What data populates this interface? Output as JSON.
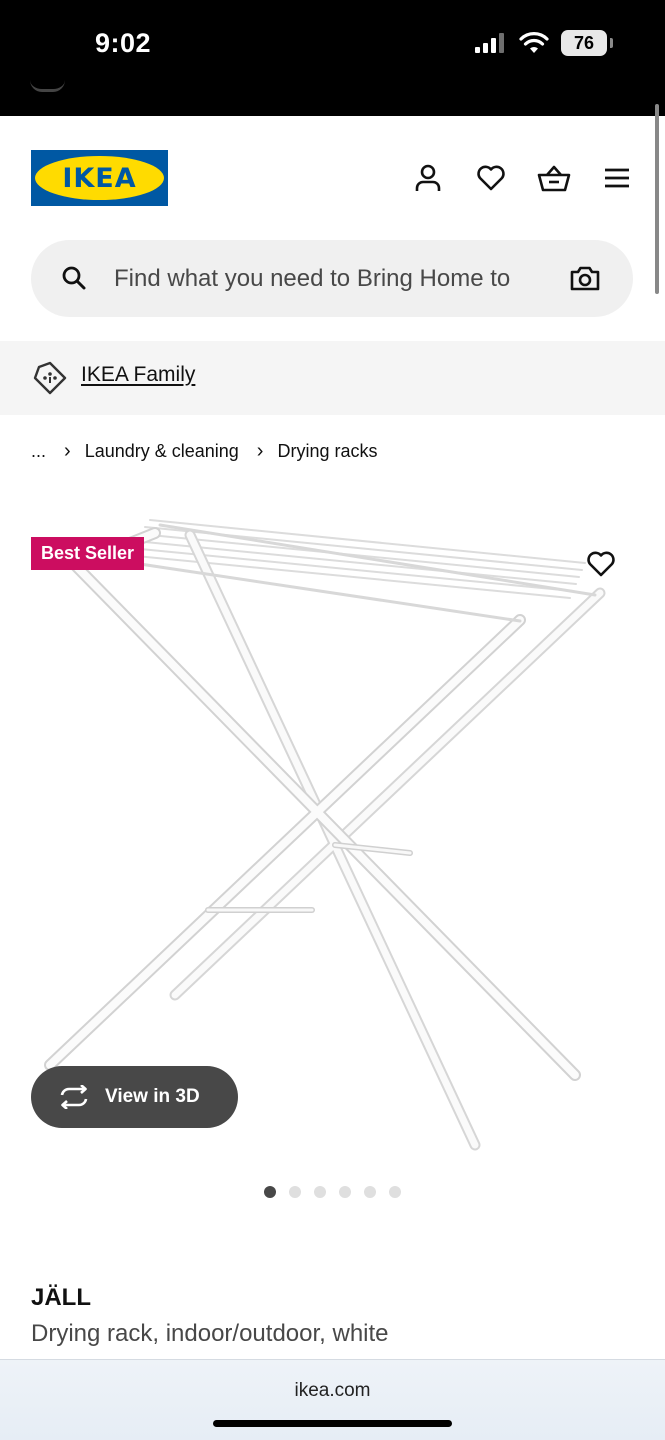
{
  "status_bar": {
    "time": "9:02",
    "battery": "76"
  },
  "header": {
    "logo_text": "IKEA"
  },
  "search": {
    "placeholder": "Find what you need to Bring Home to"
  },
  "family": {
    "label": "IKEA Family"
  },
  "breadcrumb": {
    "ellipsis": "...",
    "items": [
      "Laundry & cleaning",
      "Drying racks"
    ]
  },
  "product": {
    "badge": "Best Seller",
    "view_3d": "View in 3D",
    "name": "JÄLL",
    "description": "Drying rack, indoor/outdoor, white",
    "image_count": 6,
    "active_image": 1
  },
  "browser": {
    "url": "ikea.com"
  },
  "colors": {
    "brand_blue": "#0058a3",
    "brand_yellow": "#ffdb00",
    "badge": "#cc0d60"
  }
}
